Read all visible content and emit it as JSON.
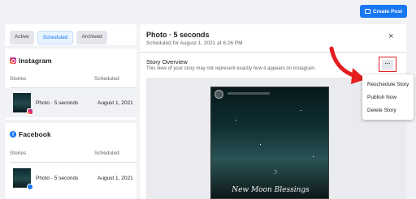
{
  "header": {
    "create_post_label": "Create Post"
  },
  "left": {
    "tabs": [
      {
        "label": "Active",
        "active": false
      },
      {
        "label": "Scheduled",
        "active": true
      },
      {
        "label": "Archived",
        "active": false
      }
    ],
    "instagram": {
      "title": "Instagram",
      "col_stories": "Stories",
      "col_scheduled": "Scheduled",
      "row": {
        "name": "Photo · 5 seconds",
        "date": "August 1, 2021"
      }
    },
    "facebook": {
      "title": "Facebook",
      "col_stories": "Stories",
      "col_scheduled": "Scheduled",
      "row": {
        "name": "Photo · 5 seconds",
        "date": "August 1, 2021"
      }
    }
  },
  "detail": {
    "title": "Photo · 5 seconds",
    "subtitle": "Scheduled for August 1, 2021 at 6:26 PM",
    "close_icon": "×",
    "overview_title": "Story Overview",
    "overview_sub": "This view of your story may not represent exactly how it appears on Instagram.",
    "story_text": "New Moon Blessings",
    "moon_glyph": "☽"
  },
  "more_menu": {
    "button_glyph": "···",
    "items": [
      "Reschedule Story",
      "Publish Now",
      "Delete Story"
    ]
  },
  "colors": {
    "accent": "#1877f2",
    "highlight": "#e41e1e"
  }
}
